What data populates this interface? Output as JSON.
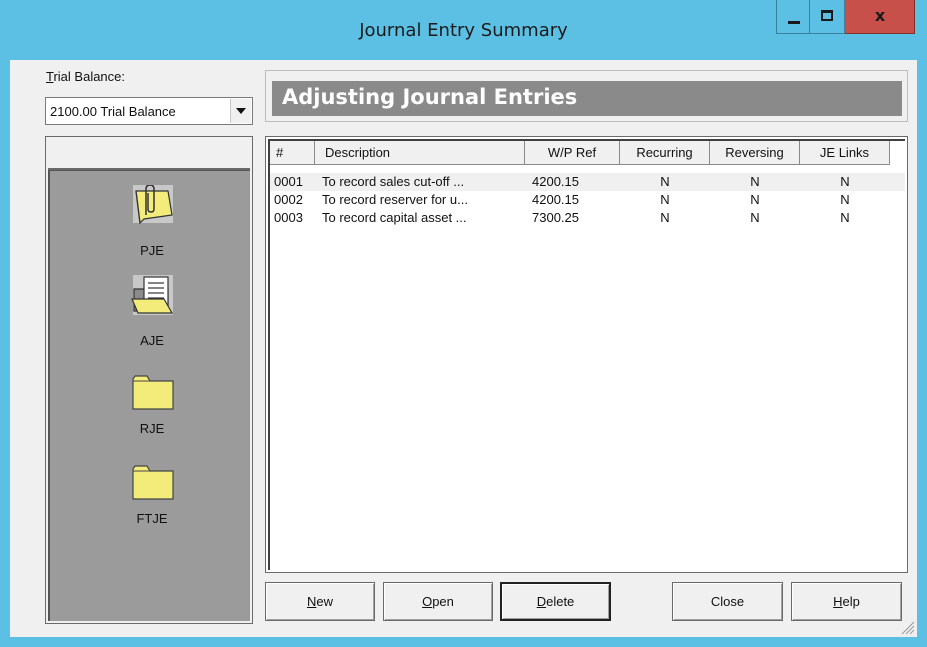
{
  "window": {
    "title": "Journal Entry Summary",
    "close_glyph": "x"
  },
  "trial_balance": {
    "label_prefix": "T",
    "label_rest": "rial Balance:",
    "selected": "2100.00 Trial Balance"
  },
  "journal_types": [
    {
      "label": "PJE",
      "icon": "paperclip-folder-icon"
    },
    {
      "label": "AJE",
      "icon": "open-folder-document-icon"
    },
    {
      "label": "RJE",
      "icon": "folder-icon"
    },
    {
      "label": "FTJE",
      "icon": "folder-icon"
    }
  ],
  "header": {
    "title": "Adjusting Journal Entries"
  },
  "table": {
    "columns": [
      "#",
      "Description",
      "W/P Ref",
      "Recurring",
      "Reversing",
      "JE Links"
    ],
    "rows": [
      {
        "num": "0001",
        "description": "To record sales cut-off ...",
        "wp_ref": "4200.15",
        "recurring": "N",
        "reversing": "N",
        "je_links": "N"
      },
      {
        "num": "0002",
        "description": "To record reserver for u...",
        "wp_ref": "4200.15",
        "recurring": "N",
        "reversing": "N",
        "je_links": "N"
      },
      {
        "num": "0003",
        "description": "To record capital asset ...",
        "wp_ref": "7300.25",
        "recurring": "N",
        "reversing": "N",
        "je_links": "N"
      }
    ]
  },
  "buttons": {
    "new_u": "N",
    "new_rest": "ew",
    "open_u": "O",
    "open_rest": "pen",
    "delete_u": "D",
    "delete_rest": "elete",
    "close": "Close",
    "help_u": "H",
    "help_rest": "elp"
  },
  "colors": {
    "titlebar": "#5bc0e3",
    "close_button": "#c7504a",
    "header_bar": "#8a8a8a",
    "sidebar_body": "#9b9b9b",
    "folder_yellow": "#f3ec7a"
  }
}
